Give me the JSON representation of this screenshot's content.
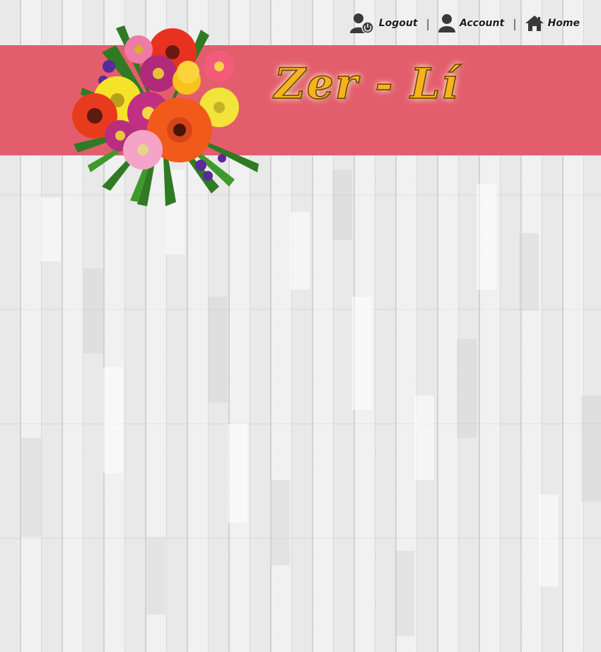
{
  "nav": {
    "logout_label": "Logout",
    "account_label": "Account",
    "home_label": "Home",
    "separator": "|"
  },
  "brand": {
    "title": "Zer - Lí"
  },
  "icons": {
    "logout": "user-power-icon",
    "account": "user-icon",
    "home": "home-icon"
  },
  "colors": {
    "banner": "#e35e6d",
    "title_fill": "#f7b31c",
    "title_outline": "#6b3a07",
    "nav_text": "#1c1c1c"
  }
}
